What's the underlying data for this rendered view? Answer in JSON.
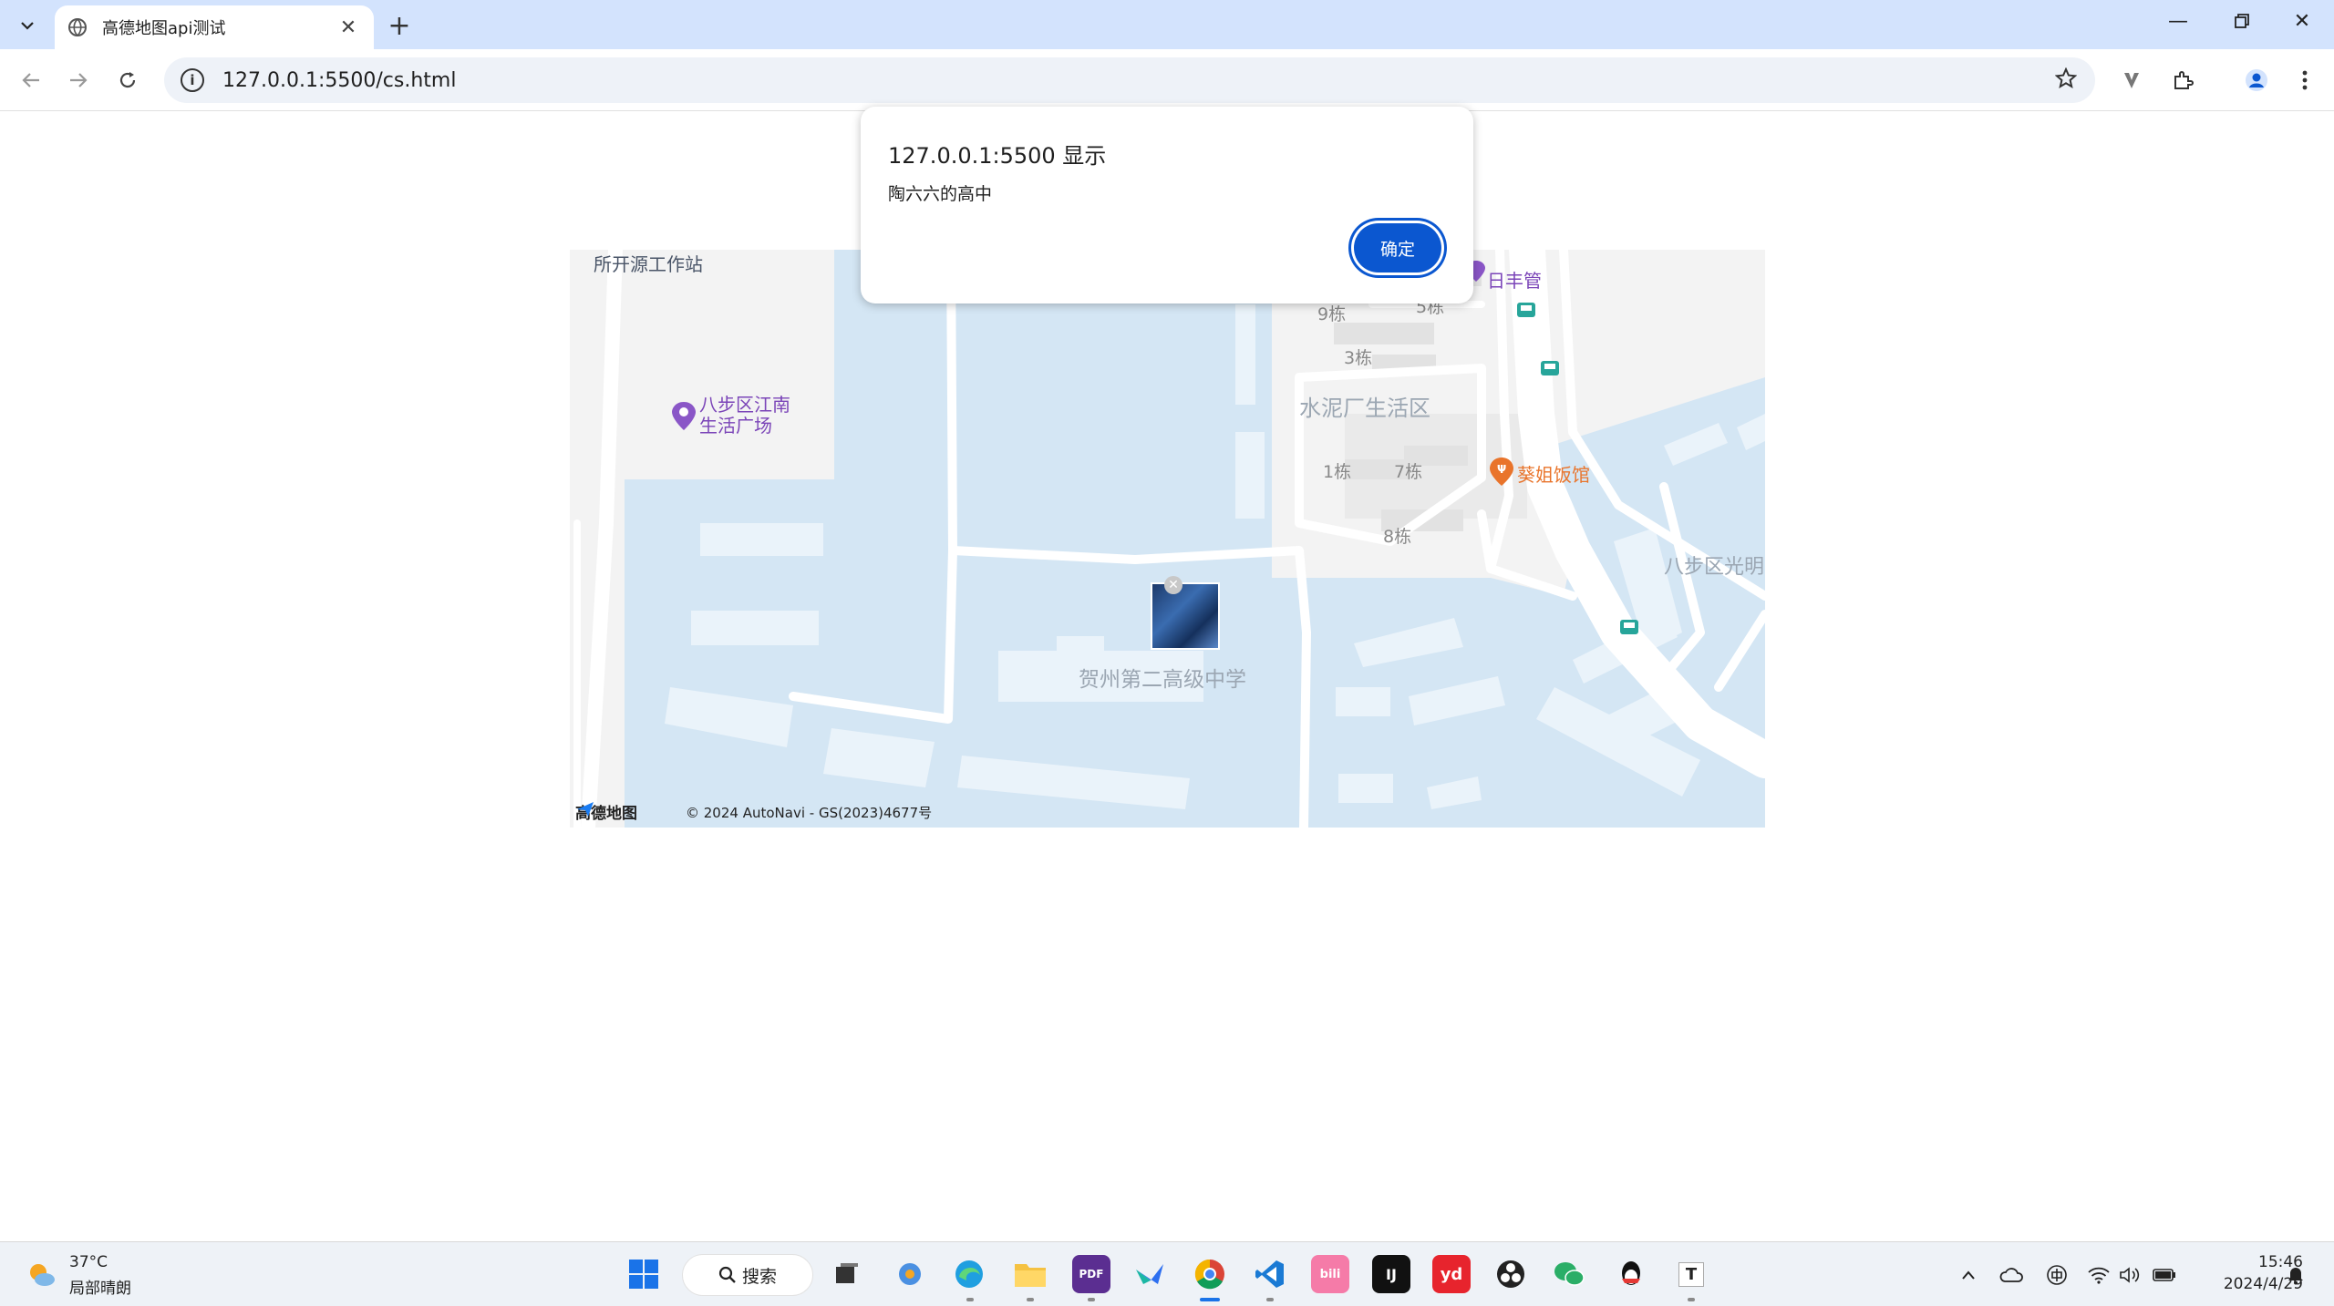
{
  "browser": {
    "tab_title": "高德地图api测试",
    "url": "127.0.0.1:5500/cs.html",
    "new_tab_symbol": "+"
  },
  "dialog": {
    "title": "127.0.0.1:5500 显示",
    "message": "陶六六的高中",
    "ok_label": "确定"
  },
  "map": {
    "labels": {
      "station": "所开源工作站",
      "plaza_line1": "八步区江南",
      "plaza_line2": "生活广场",
      "rifeng": "日丰管",
      "living_area": "水泥厂生活区",
      "b9": "9栋",
      "b5": "5栋",
      "b3": "3栋",
      "b1": "1栋",
      "b7": "7栋",
      "b8": "8栋",
      "restaurant": "葵姐饭馆",
      "babu_guang": "八步区光明",
      "school": "贺州第二高级中学"
    },
    "logo_text": "高德地图",
    "copyright": "© 2024 AutoNavi - GS(2023)4677号",
    "colors": {
      "water": "#d4e6f4",
      "land": "#f3f3f3",
      "road": "#ffffff",
      "poi_purple": "#8a56c7",
      "poi_orange": "#e9742b"
    }
  },
  "taskbar": {
    "weather_temp": "37°C",
    "weather_desc": "局部晴朗",
    "search_label": "搜索",
    "time": "15:46",
    "date": "2024/4/29"
  }
}
